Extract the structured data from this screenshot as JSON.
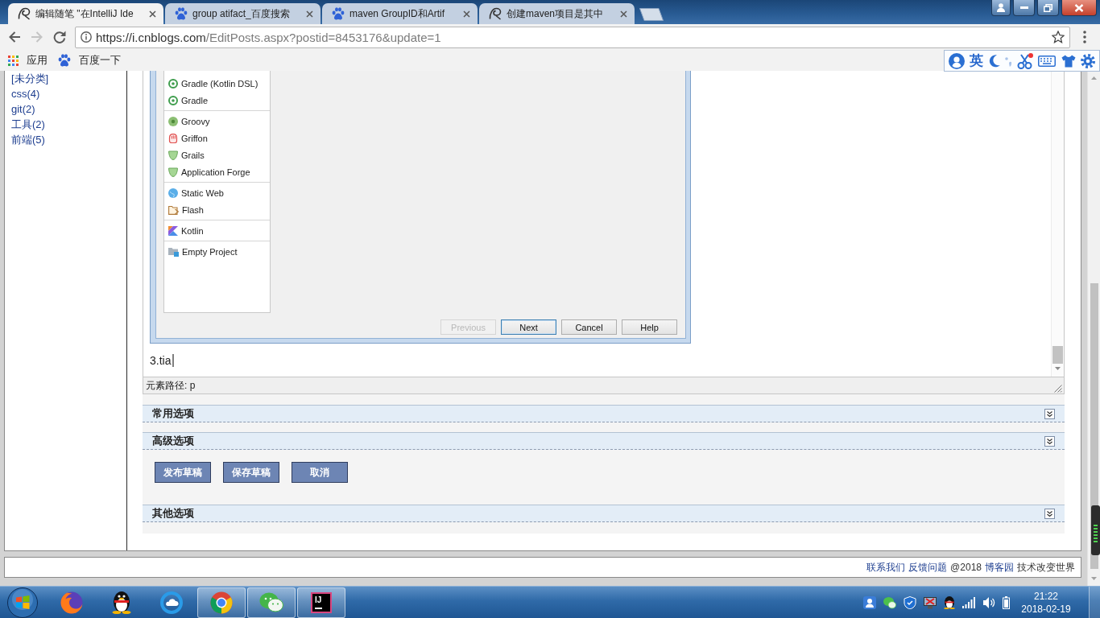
{
  "tabs": [
    {
      "kind": "blog",
      "title": "编辑随笔 \"在IntelliJ Ide",
      "selected": true
    },
    {
      "kind": "paw",
      "title": "group atifact_百度搜索",
      "selected": false
    },
    {
      "kind": "paw",
      "title": "maven GroupID和Artif",
      "selected": false
    },
    {
      "kind": "blog",
      "title": "创建maven项目是其中",
      "selected": false
    }
  ],
  "toolbar": {
    "nav_buttons": [
      {
        "kind": "back",
        "disabled": false
      },
      {
        "kind": "forward",
        "disabled": true
      },
      {
        "kind": "reload",
        "disabled": false
      }
    ],
    "address": {
      "origin": "https://i.cnblogs.com",
      "path": "/EditPosts.aspx?postid=8453176&update=1"
    }
  },
  "bookmarks": [
    {
      "kind": "apps",
      "label": "应用"
    },
    {
      "kind": "paw",
      "label": "百度一下"
    }
  ],
  "ime_toolbar": {
    "mode": "英"
  },
  "sidebar": {
    "categories": [
      "[未分类]",
      "css(4)",
      "git(2)",
      "工具(2)",
      "前端(5)"
    ]
  },
  "editor": {
    "dialog": {
      "groups": [
        {
          "items": [
            {
              "kind": "gradle",
              "label": "Gradle (Kotlin DSL)"
            },
            {
              "kind": "gradle",
              "label": "Gradle"
            }
          ]
        },
        {
          "items": [
            {
              "kind": "groovy",
              "label": "Groovy"
            },
            {
              "kind": "griffon",
              "label": "Griffon"
            },
            {
              "kind": "grails",
              "label": "Grails"
            },
            {
              "kind": "grails",
              "label": "Application Forge"
            }
          ]
        },
        {
          "items": [
            {
              "kind": "web",
              "label": "Static Web"
            },
            {
              "kind": "flash",
              "label": "Flash"
            }
          ]
        },
        {
          "items": [
            {
              "kind": "kotlin",
              "label": "Kotlin"
            }
          ]
        },
        {
          "items": [
            {
              "kind": "empty",
              "label": "Empty Project"
            }
          ]
        }
      ],
      "buttons": [
        {
          "label": "Previous",
          "disabled": true,
          "focused": false
        },
        {
          "label": "Next",
          "disabled": false,
          "focused": true
        },
        {
          "label": "Cancel",
          "disabled": false,
          "focused": false
        },
        {
          "label": "Help",
          "disabled": false,
          "focused": false
        }
      ]
    },
    "text": "3.tia",
    "element_path": "元素路径: p"
  },
  "options": [
    {
      "kind": "section",
      "title": "常用选项",
      "expanded": false
    },
    {
      "kind": "section",
      "title": "高级选项",
      "expanded": false
    },
    {
      "kind": "actions",
      "buttons": [
        "发布草稿",
        "保存草稿",
        "取消"
      ]
    },
    {
      "kind": "section",
      "title": "其他选项",
      "expanded": false
    }
  ],
  "footer": [
    {
      "kind": "link",
      "text": "联系我们"
    },
    {
      "kind": "link",
      "text": "反馈问题"
    },
    {
      "kind": "text",
      "text": "@2018"
    },
    {
      "kind": "link",
      "text": "博客园"
    },
    {
      "kind": "text",
      "text": "技术改变世界"
    }
  ],
  "taskbar": {
    "apps": [
      {
        "kind": "fox",
        "open": false
      },
      {
        "kind": "penguin",
        "open": false
      },
      {
        "kind": "ring",
        "open": false
      },
      {
        "kind": "wheel",
        "open": true
      },
      {
        "kind": "chat",
        "open": true
      },
      {
        "kind": "tile",
        "label": "IJ",
        "open": true
      }
    ],
    "clock": {
      "time": "21:22",
      "date": "2018-02-19"
    }
  }
}
